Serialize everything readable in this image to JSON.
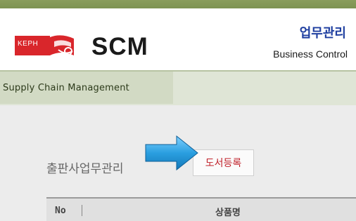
{
  "header": {
    "logo_text": "KEPH",
    "app_title": "SCM",
    "module_title_kr": "업무관리",
    "module_title_en": "Business Control"
  },
  "subheader": {
    "label": "Supply Chain Management"
  },
  "main": {
    "section_title": "출판사업무관리",
    "register_button_label": "도서등록"
  },
  "table": {
    "columns": [
      "No",
      "상품명"
    ]
  },
  "colors": {
    "top_strip": "#7e9352",
    "logo_red": "#d9262b",
    "module_title": "#1f3fa0",
    "button_text": "#c0212a",
    "arrow_blue": "#2a9fe0"
  }
}
